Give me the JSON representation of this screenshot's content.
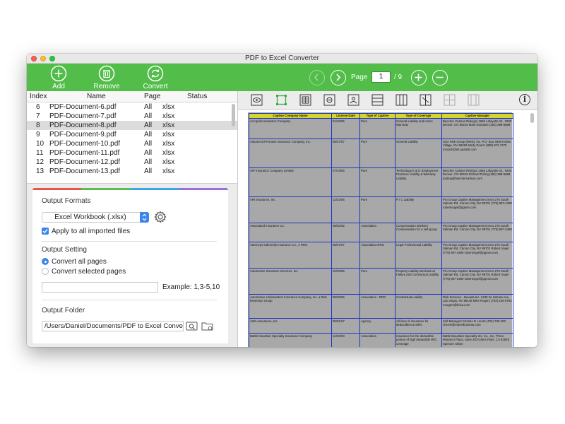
{
  "window": {
    "title": "PDF to Excel Converter"
  },
  "toolbar": {
    "add_label": "Add",
    "remove_label": "Remove",
    "convert_label": "Convert",
    "page_label": "Page",
    "page_current": "1",
    "page_total": "/ 9"
  },
  "file_table": {
    "headers": {
      "index": "Index",
      "name": "Name",
      "page": "Page",
      "status": "Status"
    },
    "rows": [
      {
        "index": "6",
        "name": "PDF-Document-6.pdf",
        "page": "All",
        "status": "xlsx"
      },
      {
        "index": "7",
        "name": "PDF-Document-7.pdf",
        "page": "All",
        "status": "xlsx"
      },
      {
        "index": "8",
        "name": "PDF-Document-8.pdf",
        "page": "All",
        "status": "xlsx"
      },
      {
        "index": "9",
        "name": "PDF-Document-9.pdf",
        "page": "All",
        "status": "xlsx"
      },
      {
        "index": "10",
        "name": "PDF-Document-10.pdf",
        "page": "All",
        "status": "xlsx"
      },
      {
        "index": "11",
        "name": "PDF-Document-11.pdf",
        "page": "All",
        "status": "xlsx"
      },
      {
        "index": "12",
        "name": "PDF-Document-12.pdf",
        "page": "All",
        "status": "xlsx"
      },
      {
        "index": "13",
        "name": "PDF-Document-13.pdf",
        "page": "All",
        "status": "xlsx"
      }
    ],
    "selected_index": "8"
  },
  "settings": {
    "strip_colors": [
      "#e8564b",
      "#59bf4f",
      "#3ba6e8",
      "#9b6fd8"
    ],
    "output_formats_title": "Output Formats",
    "format_selected": "Excel Workbook (.xlsx)",
    "apply_all_label": "Apply to all imported files",
    "output_setting_title": "Output Setting",
    "convert_all_label": "Convert all pages",
    "convert_selected_label": "Convert selected pages",
    "pages_value": "",
    "example_label": "Example: 1,3-5,10",
    "output_folder_title": "Output Folder",
    "folder_path": "/Users/Daniel/Documents/PDF to Excel Converter"
  },
  "document": {
    "headers": [
      "Captive Company Name",
      "License Date",
      "Type of Captive",
      "Type of Coverage",
      "Captive Manager"
    ],
    "rows": [
      [
        "Acropolis Insurance Company",
        "01/19/06",
        "Pure",
        "General Liability and Home Warranty",
        "Beecher Carlson Risk(op) 1655 Lafayette St., #200 Denver, CO 80218 Mark Dumaine (303) 398-5688"
      ],
      [
        "Advanced Premium Insurance Company, Inc.",
        "08/27/07",
        "Pure",
        "General Liability",
        "USA Risk Group (West), Inc. P.O. Box 4939 Incline Village, NV 89450 Marty Roach (888) 872-7475 mroach@mt.usarisk.com"
      ],
      [
        "AIP Insurance Company Limited",
        "07/14/06",
        "Pure",
        "Technology E & O Employment Practices Liability & Warranty Liability",
        "Beecher Carlson Risk(op) 1655 Lafayette St., #200 Denver, CO 80218 Richard Poling (303) 398-5688 rpoling@beechercarlson.com"
      ],
      [
        "ARI Insurance, Inc.",
        "12/21/06",
        "Pure",
        "P / C Liability",
        "Pro Group Captive Management Svcs 275 South Salman Rd. Carson City, NV 89701 (775) 887-2480 robertvogel@pgmsv.com"
      ],
      [
        "Associated Insurance Co.",
        "05/20/02",
        "Association",
        "Compensation Workers' Compensation for a self-group",
        "Pro Group Captive Management Svcs 275 South Salman Rd. Carson City, NV 89701 (775) 887-2480"
      ],
      [
        "Attorneys Indemnity Insurance Co., A RRG",
        "08/27/07",
        "Association-RRG",
        "Legal Professional Liability",
        "Pro Group Captive Management Svcs 275 South Salman Rd. Carson City, NV 89701 Robert Vogel (775) 887-2480 robertvogel@pgmsv.com"
      ],
      [
        "Automotive Insurance Services, Inc.",
        "10/03/06",
        "Pure",
        "Property Liability Mechanical Failure and Contractual Liability",
        "Pro Group Captive Management Svcs 275 South Salman Rd. Carson City, NV 89701 Robert Vogel (775) 887-2480 robertvogel@pgmsv.com"
      ],
      [
        "Automotive Underwriters Insurance Company, Inc. a Risk Retention Group",
        "09/26/06",
        "Association - RRG",
        "Contractual Liability",
        "Risk Services - Nevada Inc. 5430 W. Sahara Ave. Las Vegas, NV 89146 Mike Rogers (702) 226-0793 mrogers@leisa.com"
      ],
      [
        "AWA Assurance, Inc.",
        "05/01/07",
        "Agency",
        "All lines of insurance for deductibles & SIRs",
        "Self Managed Charles D. Hersh (702) 739-200 chersh@marrelliusmao.com"
      ],
      [
        "Battle Mountain Specialty Insurance Company",
        "12/29/03",
        "Association",
        "Insurance for the deductible portion of high deductible W/C coverage",
        "Battle Mountain Specialty Ins. Co., Inc. Three Monarch Plaza, Suite 203 Glens Point, CA 92629 Spencer Olsen"
      ]
    ]
  }
}
